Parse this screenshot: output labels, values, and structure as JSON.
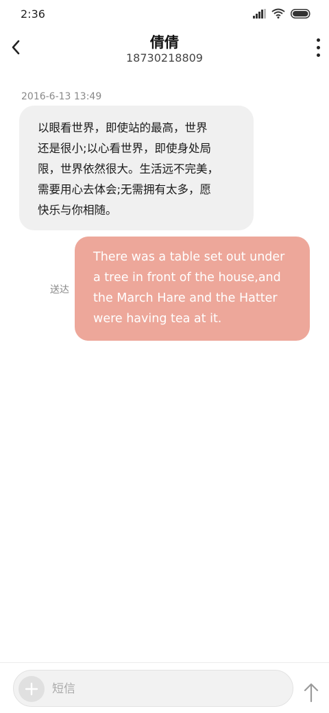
{
  "status_bar": {
    "time": "2:36",
    "icons": [
      "signal-icon",
      "wifi-icon",
      "battery-icon"
    ]
  },
  "header": {
    "contact_name": "倩倩",
    "contact_number": "18730218809",
    "back_icon": "chevron-left-icon",
    "more_icon": "more-vertical-icon"
  },
  "messages": [
    {
      "direction": "incoming",
      "timestamp": "2016-6-13 13:49",
      "lines": [
        "以眼看世界，即使站的最高，世界",
        "还是很小;以心看世界，即使身处局",
        "限，世界依然很大。生活远不完美，",
        "需要用心去体会;无需拥有太多，愿",
        "快乐与你相随。"
      ]
    },
    {
      "direction": "outgoing",
      "status": "送达",
      "lines": [
        "There was a table set out under",
        "a tree in front of the house,and",
        "the March Hare and the Hatter",
        "were having tea at it."
      ]
    }
  ],
  "composer": {
    "placeholder": "短信",
    "value": "",
    "add_icon": "plus-icon",
    "send_icon": "arrow-up-icon"
  },
  "colors": {
    "incoming_bubble": "#f0f0f0",
    "outgoing_bubble": "#eda79a",
    "outgoing_text": "#ffffff"
  }
}
